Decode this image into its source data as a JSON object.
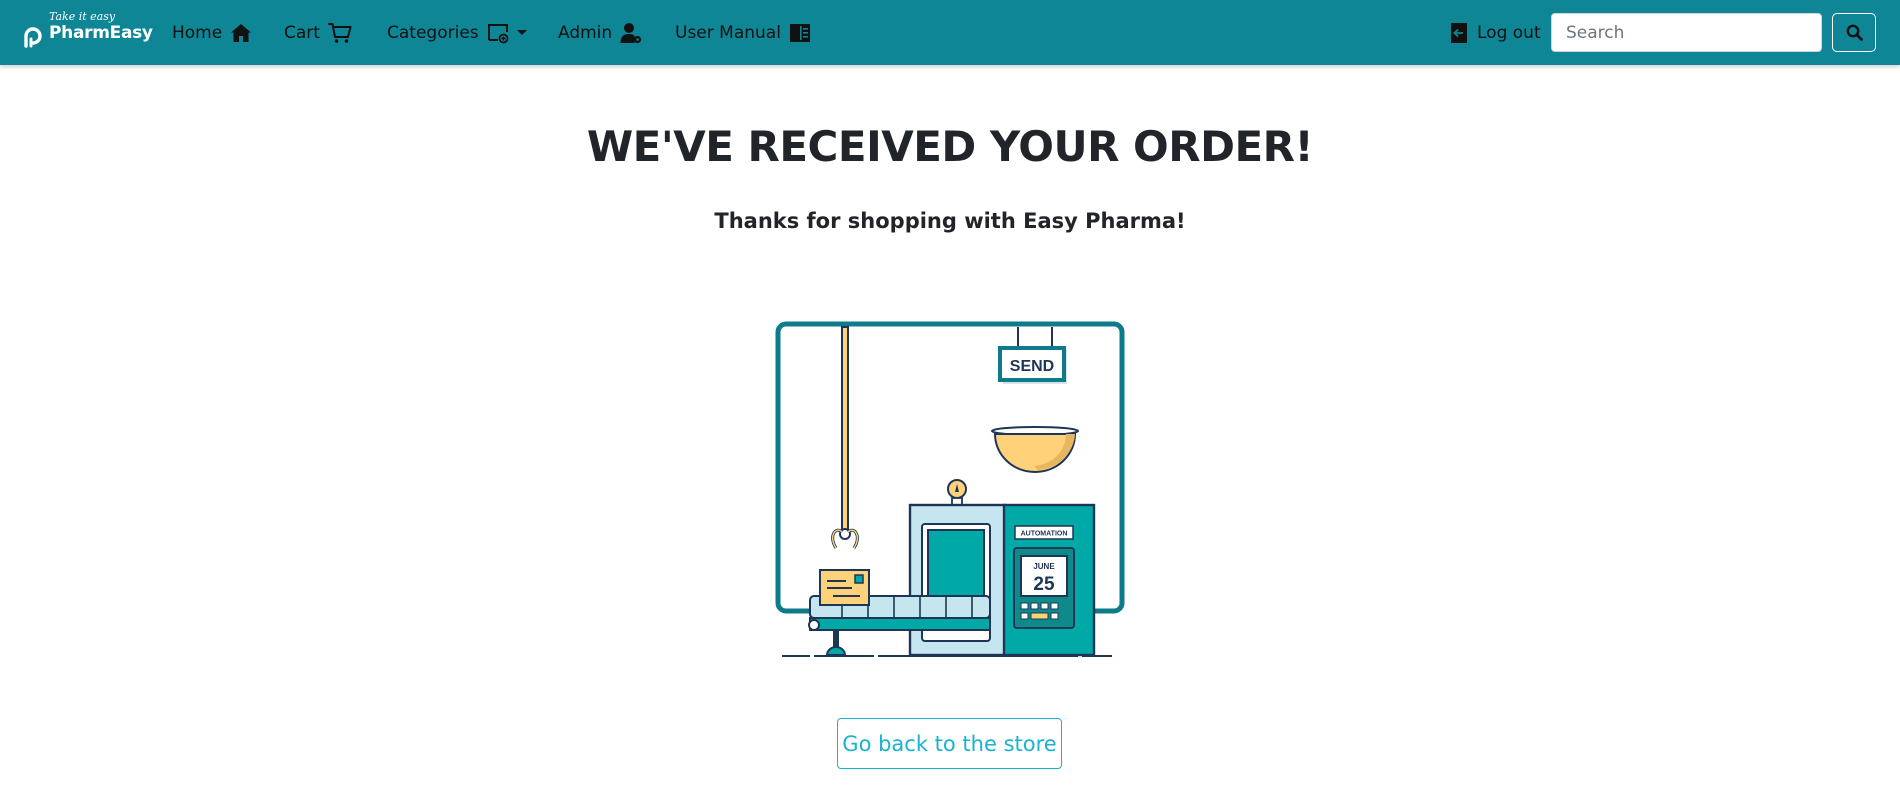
{
  "brand": {
    "tagline": "Take it easy",
    "name": "PharmEasy"
  },
  "nav": {
    "home": {
      "label": "Home",
      "icon": "home-icon"
    },
    "cart": {
      "label": "Cart",
      "icon": "cart-icon"
    },
    "categories": {
      "label": "Categories",
      "icon": "categories-icon"
    },
    "admin": {
      "label": "Admin",
      "icon": "admin-user-icon"
    },
    "manual": {
      "label": "User Manual",
      "icon": "book-icon"
    },
    "logout": {
      "label": "Log out",
      "icon": "logout-icon"
    }
  },
  "search": {
    "placeholder": "Search",
    "value": ""
  },
  "main": {
    "title": "WE'VE RECEIVED YOUR ORDER!",
    "subtitle": "Thanks for shopping with Easy Pharma!",
    "back_button": "Go back to the store"
  },
  "illustration": {
    "sign": "SEND",
    "panel_label": "AUTOMATION",
    "month": "JUNE",
    "day": "25"
  },
  "colors": {
    "navbar": "#0e8696",
    "teal": "#00a9a6",
    "outline": "#1d3557",
    "yellow": "#ffd27a",
    "button_accent": "#17b3d1"
  }
}
